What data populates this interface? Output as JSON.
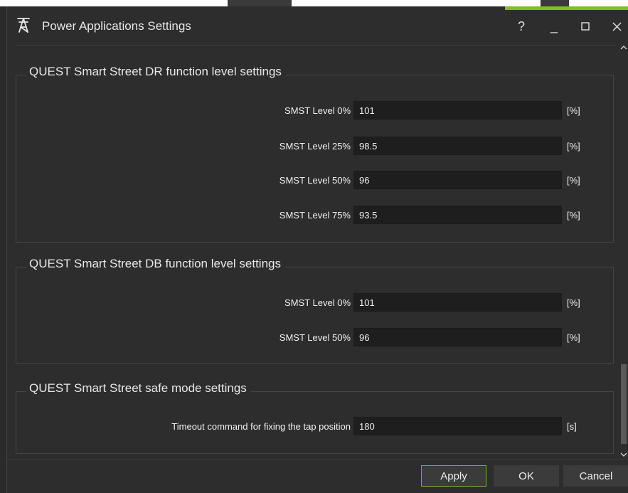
{
  "window": {
    "title": "Power Applications Settings",
    "accent_color": "#7fbf1f",
    "controls": {
      "help": "?",
      "minimize": "_",
      "maximize": "☐",
      "close": "✕"
    }
  },
  "groups": [
    {
      "title": "QUEST Smart Street DR function level settings",
      "rows": [
        {
          "label": "SMST Level 0%",
          "value": "101",
          "unit": "[%]"
        },
        {
          "label": "SMST Level 25%",
          "value": "98.5",
          "unit": "[%]"
        },
        {
          "label": "SMST Level 50%",
          "value": "96",
          "unit": "[%]"
        },
        {
          "label": "SMST Level 75%",
          "value": "93.5",
          "unit": "[%]"
        }
      ]
    },
    {
      "title": "QUEST Smart Street DB function level settings",
      "rows": [
        {
          "label": "SMST Level 0%",
          "value": "101",
          "unit": "[%]"
        },
        {
          "label": "SMST Level 50%",
          "value": "96",
          "unit": "[%]"
        }
      ]
    },
    {
      "title": "QUEST Smart Street safe mode settings",
      "rows": [
        {
          "label": "Timeout command for fixing the tap position",
          "value": "180",
          "unit": "[s]"
        }
      ]
    }
  ],
  "footer": {
    "apply_label": "Apply",
    "ok_label": "OK",
    "cancel_label": "Cancel"
  },
  "scrollbar": {
    "up_icon": "chevron-up-icon",
    "down_icon": "chevron-down-icon"
  }
}
